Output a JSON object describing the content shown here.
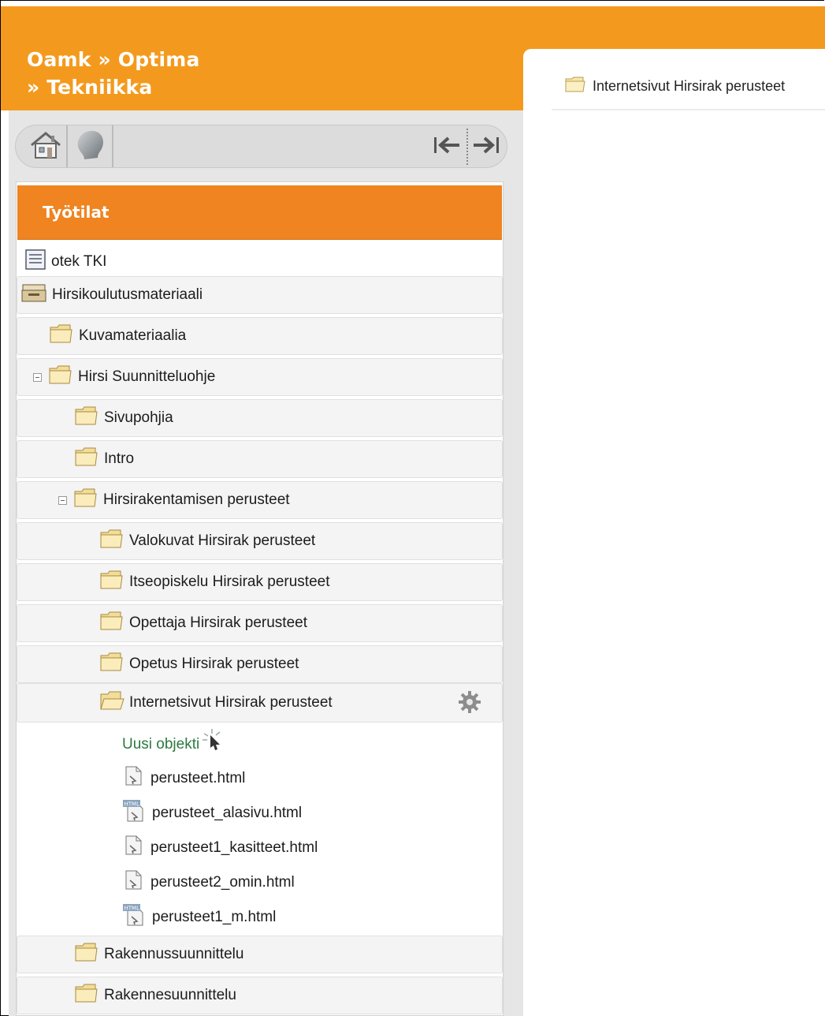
{
  "header": {
    "site_title_line1": "Oamk » Optima",
    "site_title_line2": "» Tekniikka",
    "accent_color": "#f39a1e"
  },
  "breadcrumb": {
    "current": "Internetsivut Hirsirak perusteet"
  },
  "toolbar": {
    "home_icon": "home-icon",
    "profile_icon": "profile-head-icon",
    "collapse_icon": "arrow-left-icon",
    "expand_icon": "arrow-right-icon"
  },
  "panel": {
    "title": "Työtilat"
  },
  "tree": {
    "items": [
      {
        "label": "otek TKI",
        "icon": "document-icon"
      },
      {
        "label": "Hirsikoulutusmateriaali",
        "icon": "archive-icon"
      },
      {
        "label": "Kuvamateriaalia",
        "icon": "folder-icon"
      },
      {
        "label": "Hirsi Suunnitteluohje",
        "icon": "folder-icon",
        "expanded": true
      },
      {
        "label": "Sivupohjia",
        "icon": "folder-icon"
      },
      {
        "label": "Intro",
        "icon": "folder-icon"
      },
      {
        "label": "Hirsirakentamisen perusteet",
        "icon": "folder-icon",
        "expanded": true
      },
      {
        "label": "Valokuvat Hirsirak perusteet",
        "icon": "folder-icon"
      },
      {
        "label": "Itseopiskelu Hirsirak perusteet",
        "icon": "folder-icon"
      },
      {
        "label": "Opettaja Hirsirak perusteet",
        "icon": "folder-icon"
      },
      {
        "label": "Opetus Hirsirak perusteet",
        "icon": "folder-icon"
      },
      {
        "label": "Internetsivut Hirsirak perusteet",
        "icon": "folder-open-icon",
        "selected": true
      },
      {
        "label": "Rakennussuunnittelu",
        "icon": "folder-icon"
      },
      {
        "label": "Rakennesuunnittelu",
        "icon": "folder-icon"
      }
    ],
    "new_object": "Uusi objekti",
    "files": [
      {
        "label": "perusteet.html",
        "icon": "file-icon"
      },
      {
        "label": "perusteet_alasivu.html",
        "icon": "html-file-icon"
      },
      {
        "label": "perusteet1_kasitteet.html",
        "icon": "file-icon"
      },
      {
        "label": "perusteet2_omin.html",
        "icon": "file-icon"
      },
      {
        "label": "perusteet1_m.html",
        "icon": "html-file-icon"
      }
    ]
  }
}
